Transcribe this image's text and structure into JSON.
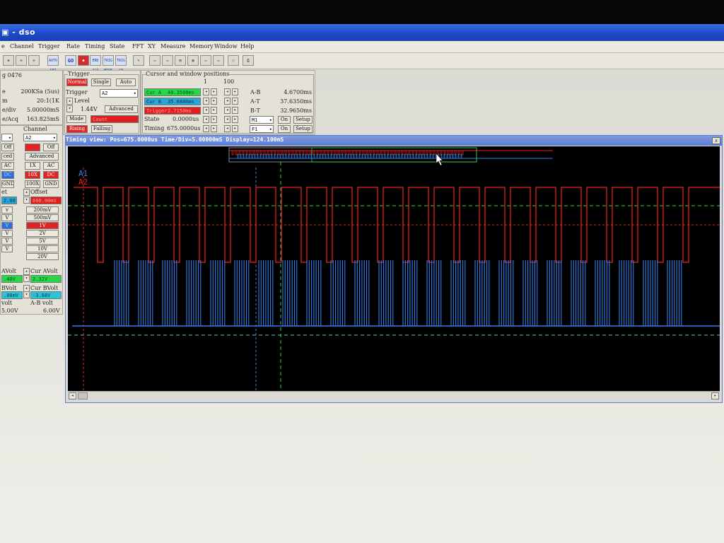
{
  "window": {
    "title": "▣ - dso"
  },
  "menu": [
    "e",
    "Channel",
    "Trigger",
    "Rate",
    "Timing",
    "State",
    "FFT",
    "XY",
    "Measure",
    "Memory",
    "Window",
    "Help"
  ],
  "toolbar": {
    "buttons": [
      "zoom-in",
      "zoom-out",
      "zoom-fit",
      "AUTO SET",
      "GO",
      "STOP",
      "END ACQ",
      "TRIG MODE",
      "TRIG CH",
      "tool",
      "win1",
      "win2",
      "win3",
      "win4",
      "win5",
      "win6",
      "print"
    ],
    "auto_set": "AUTO SET",
    "go": "GO",
    "end_acq": "END ACQ",
    "trig_mode": "TRIG MODE",
    "trig_ch": "TRIG CH"
  },
  "acq_panel": {
    "header": "g 0476",
    "rows": [
      {
        "label": "e",
        "value": "200KSa (5us)"
      },
      {
        "label": "m",
        "value": "20:1(1K"
      },
      {
        "label": "e/div",
        "value": "5.00000mS"
      },
      {
        "label": "e/Acq",
        "value": "163.825mS"
      }
    ]
  },
  "trigger": {
    "title": "Trigger",
    "mode_buttons": {
      "normal": "Normal",
      "single": "Single",
      "auto": "Auto"
    },
    "trigger_label": "Trigger",
    "source": "A2",
    "level_label": "Level",
    "level_value": "1.44V",
    "advanced": "Advanced",
    "mode_label": "Mode",
    "mode_value": "Count",
    "rising": "Rising",
    "falling": "Falling"
  },
  "cursor_group": {
    "title": "Cursor and window positions",
    "scale_min": "1",
    "scale_max": "100",
    "rows": [
      {
        "label": "Cur A",
        "value": "40.3500ms",
        "color": "green"
      },
      {
        "label": "Cur B",
        "value": "35.6800ms",
        "color": "blue"
      },
      {
        "label": "Trigger",
        "value": "2.7150ms",
        "color": "red"
      },
      {
        "label": "State",
        "value": "0.0000us",
        "color": "plain"
      },
      {
        "label": "Timing",
        "value": "675.0000us",
        "color": "plain"
      }
    ],
    "measures": [
      {
        "label": "A-B",
        "value": "4.6700ms"
      },
      {
        "label": "A-T",
        "value": "37.6350ms"
      },
      {
        "label": "B-T",
        "value": "32.9650ms"
      }
    ],
    "m1": "M1",
    "f1": "F1",
    "on": "On",
    "setup": "Setup"
  },
  "channel_panel": {
    "title": "Channel",
    "source": "A2",
    "off": "Off",
    "advanced": "Advanced",
    "ced": "ced",
    "ac": "AC",
    "dc": "DC",
    "x1": "1X",
    "x10": "10X",
    "x100": "100X",
    "gnd": "GND",
    "offset": "Offset",
    "offset_value": "600.00mV",
    "offset_left": "2.00",
    "left_fragments": [
      "v",
      "V",
      "V",
      "V",
      "V",
      "V"
    ],
    "volts": [
      "200mV",
      "500mV",
      "1V",
      "2V",
      "5V",
      "10V",
      "20V"
    ]
  },
  "volt_readouts": {
    "avolt_label": "AVolt",
    "avolt_value": ".40V",
    "bvolt_label": "BVolt",
    "bvolt_value": ".00mV",
    "cur_avolt_label": "Cur AVolt",
    "cur_avolt_value": "2.32V",
    "cur_bvolt_label": "Cur BVolt",
    "cur_bvolt_value": "-3.68V",
    "volt_label": "volt",
    "volt_value": "5.00V",
    "ab_volt_label": "A-B volt",
    "ab_volt_value": "6.00V"
  },
  "timing_view": {
    "title": "Timing view: Pos=675.0000us Time/Div=5.00000mS Display=124.100mS",
    "close": "x",
    "channel_a1": "A1",
    "channel_a2": "A2",
    "colors": {
      "a1": "#2f7fe8",
      "a2": "#e8231b",
      "curA": "#2ad84a",
      "curB": "#3b8ad8",
      "trigger": "#e8231b"
    }
  }
}
